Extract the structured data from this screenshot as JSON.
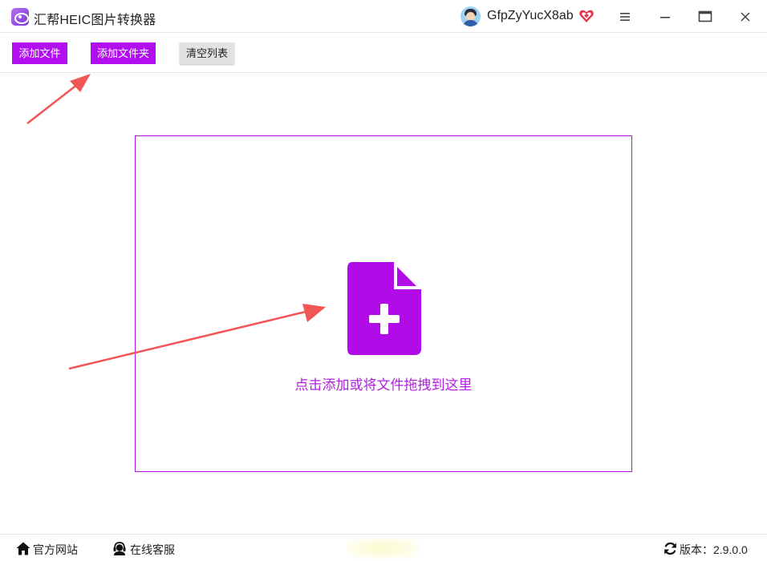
{
  "window": {
    "title": "汇帮HEIC图片转换器",
    "username": "GfpZyYucX8ab",
    "icons": {
      "logo": "app-logo-icon",
      "vip": "heart-badge-icon",
      "menu": "hamburger-menu-icon",
      "minimize": "minimize-icon",
      "maximize": "maximize-icon",
      "close": "close-icon"
    }
  },
  "toolbar": {
    "add_file_label": "添加文件",
    "add_folder_label": "添加文件夹",
    "clear_list_label": "清空列表"
  },
  "dropzone": {
    "text": "点击添加或将文件拖拽到这里",
    "icon": "file-plus-icon"
  },
  "statusbar": {
    "website_label": "官方网站",
    "support_label": "在线客服",
    "version_label": "版本：2.9.0.0"
  },
  "colors": {
    "accent": "#b20ef0",
    "drop_text": "#b21ee0",
    "arrow": "#f25555"
  }
}
